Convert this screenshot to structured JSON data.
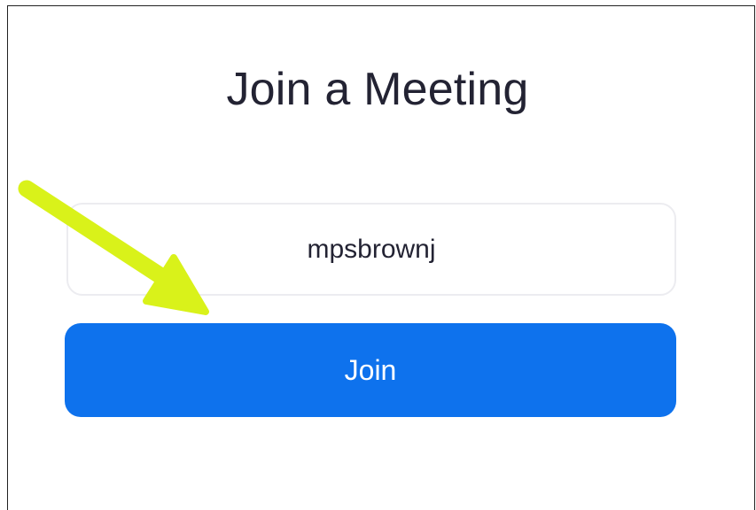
{
  "page": {
    "title": "Join a Meeting"
  },
  "meeting_field": {
    "value": "mpsbrownj"
  },
  "join_button": {
    "label": "Join"
  },
  "annotation": {
    "arrow_color": "#d9f21a"
  },
  "colors": {
    "primary": "#0e72ed",
    "title_text": "#232333",
    "input_border": "#ececf0"
  }
}
